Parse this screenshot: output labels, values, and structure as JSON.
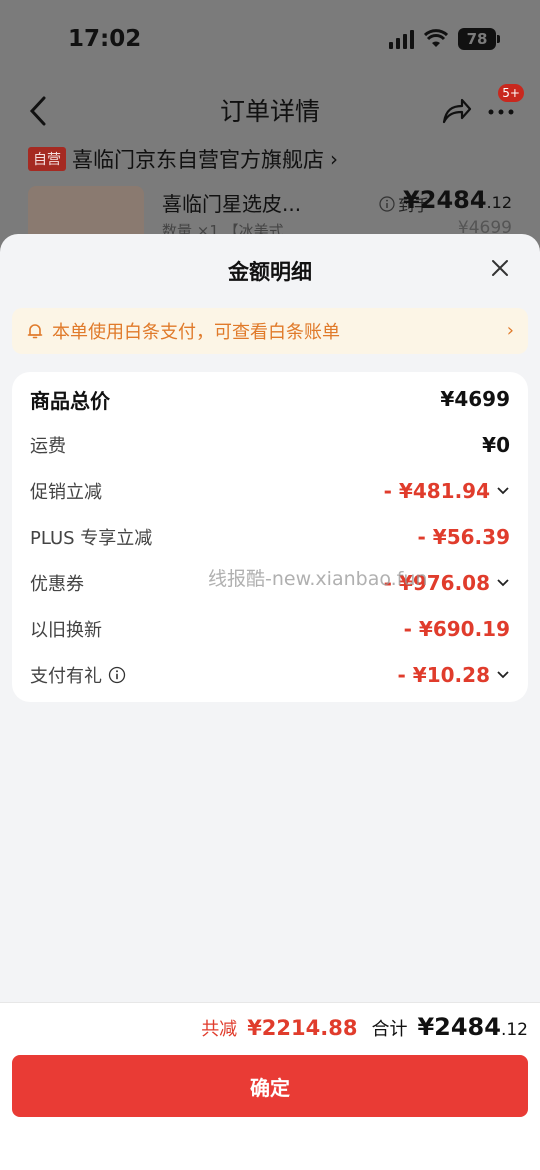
{
  "status_bar": {
    "time": "17:02",
    "battery": "78"
  },
  "nav": {
    "title": "订单详情",
    "badge": "5+"
  },
  "store": {
    "tag": "自营",
    "name": "喜临门京东自营官方旗舰店",
    "chevron": "›"
  },
  "product": {
    "name": "喜临门星选皮...",
    "qty": "数量 ×1 【冰美式",
    "price_label": "到手",
    "price_main": "¥2484",
    "price_decimal": ".12",
    "original_price": "¥4699"
  },
  "sheet": {
    "title": "金额明细",
    "notice": "本单使用白条支付，可查看白条账单",
    "rows": [
      {
        "label": "商品总价",
        "value": "¥4699"
      },
      {
        "label": "运费",
        "value": "¥0"
      },
      {
        "label": "促销立减",
        "value": "- ¥481.94"
      },
      {
        "label": "PLUS 专享立减",
        "value": "- ¥56.39"
      },
      {
        "label": "优惠券",
        "value": "- ¥976.08"
      },
      {
        "label": "以旧换新",
        "value": "- ¥690.19"
      },
      {
        "label": "支付有礼",
        "value": "- ¥10.28"
      }
    ],
    "watermark": "线报酷-new.xianbao.fun"
  },
  "footer": {
    "saved_label": "共减",
    "saved_value": "¥2214.88",
    "total_label": "合计",
    "total_main": "¥2484",
    "total_decimal": ".12",
    "confirm_label": "确定"
  },
  "colors": {
    "accent_red": "#e93b35",
    "price_red": "#e03c2c",
    "notice_orange": "#e07a2a"
  },
  "icons": [
    "back-icon",
    "share-icon",
    "more-icon",
    "close-icon",
    "bell-icon",
    "info-icon",
    "chevron-down-icon"
  ]
}
